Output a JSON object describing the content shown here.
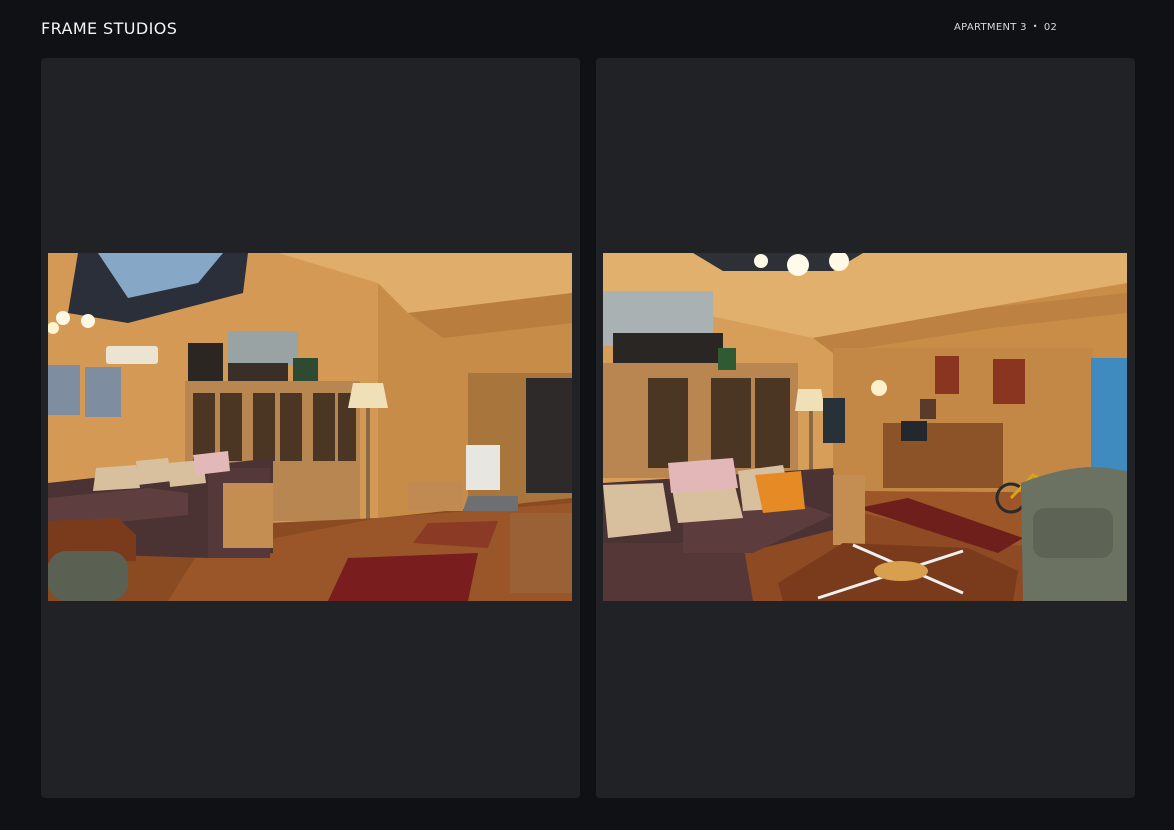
{
  "header": {
    "brand": "FRAME STUDIOS",
    "location": "APARTMENT 3",
    "separator": "•",
    "page_number": "02"
  },
  "photos": [
    {
      "name": "living-room-photo-left",
      "icon": "living-room-photo"
    },
    {
      "name": "living-room-photo-right",
      "icon": "living-room-photo"
    }
  ]
}
